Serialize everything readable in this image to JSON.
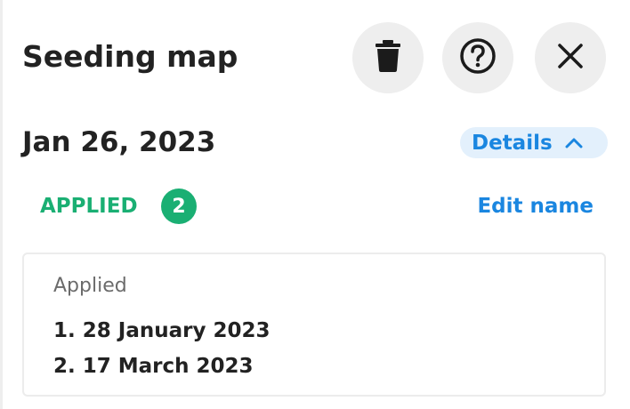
{
  "header": {
    "title": "Seeding map",
    "actions": [
      {
        "name": "delete",
        "icon": "trash-icon"
      },
      {
        "name": "help",
        "icon": "help-circle-icon"
      },
      {
        "name": "close",
        "icon": "close-icon"
      }
    ]
  },
  "record": {
    "date": "Jan 26, 2023",
    "details_label": "Details",
    "details_icon": "chevron-up-icon"
  },
  "status": {
    "label": "APPLIED",
    "count": "2",
    "edit_label": "Edit name"
  },
  "applied_card": {
    "heading": "Applied",
    "entries": [
      "1. 28 January 2023",
      "2. 17 March 2023"
    ]
  },
  "colors": {
    "accent_blue": "#1a86e0",
    "accent_blue_bg": "#e3f0fc",
    "status_green": "#1aaf73",
    "icon_button_bg": "#eeeeee",
    "text_dark": "#222222",
    "text_muted": "#6b6b6b"
  }
}
